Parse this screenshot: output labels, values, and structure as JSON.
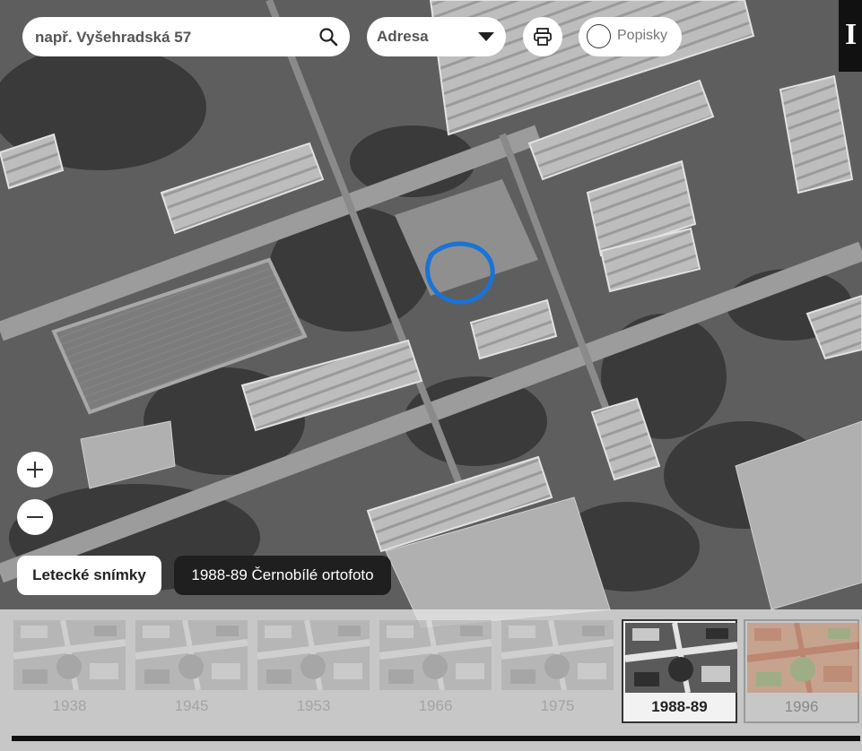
{
  "search": {
    "placeholder": "např. Vyšehradská 57"
  },
  "search_type": {
    "selected": "Adresa"
  },
  "labels_toggle": {
    "label": "Popisky",
    "checked": false
  },
  "info_tab": {
    "label": "I"
  },
  "layers": {
    "button_label": "Letecké snímky",
    "current": "1988-89 Černobílé ortofoto"
  },
  "timeline": [
    {
      "year": "1938",
      "state": "available"
    },
    {
      "year": "1945",
      "state": "available"
    },
    {
      "year": "1953",
      "state": "available"
    },
    {
      "year": "1966",
      "state": "available"
    },
    {
      "year": "1975",
      "state": "available"
    },
    {
      "year": "1988-89",
      "state": "active"
    },
    {
      "year": "1996",
      "state": "available"
    }
  ],
  "colors": {
    "marker": "#1a73d6",
    "active_border": "#333333"
  },
  "icons": {
    "search": "search-icon",
    "dropdown": "chevron-down-icon",
    "print": "printer-icon",
    "zoom_in": "plus-icon",
    "zoom_out": "minus-icon"
  }
}
